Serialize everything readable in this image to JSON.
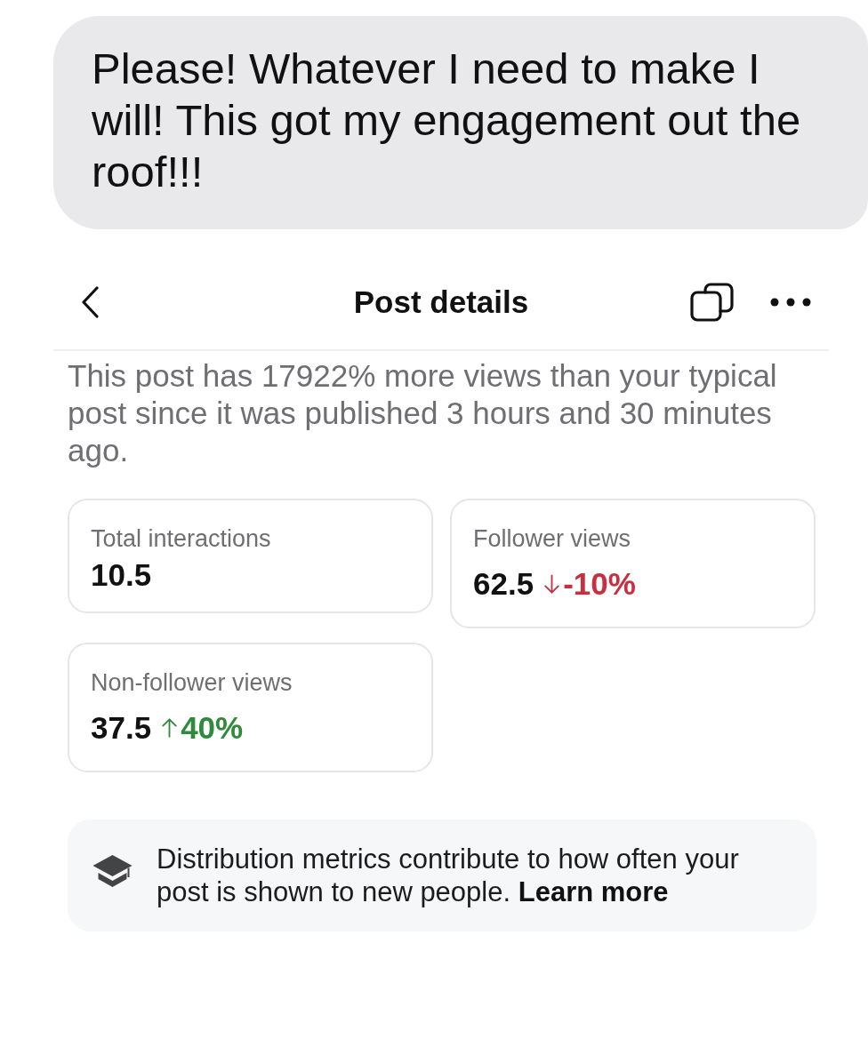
{
  "message": {
    "text": "Please! Whatever I need to make I will! This got my engagement out the roof!!!"
  },
  "header": {
    "title": "Post details"
  },
  "summary": "This post has 17922% more views than your typical post since it was published 3 hours and 30 minutes ago.",
  "metrics": [
    {
      "label": "Total interactions",
      "value": "10.5"
    },
    {
      "label": "Follower views",
      "value": "62.5",
      "change": {
        "kind": "decrease",
        "text": "-10%"
      }
    },
    {
      "label": "Non-follower views",
      "value": "37.5",
      "change": {
        "kind": "increase",
        "text": "40%"
      }
    }
  ],
  "notice": {
    "text": "Distribution metrics contribute to how often your post is shown to new people.",
    "link": "Learn more"
  }
}
